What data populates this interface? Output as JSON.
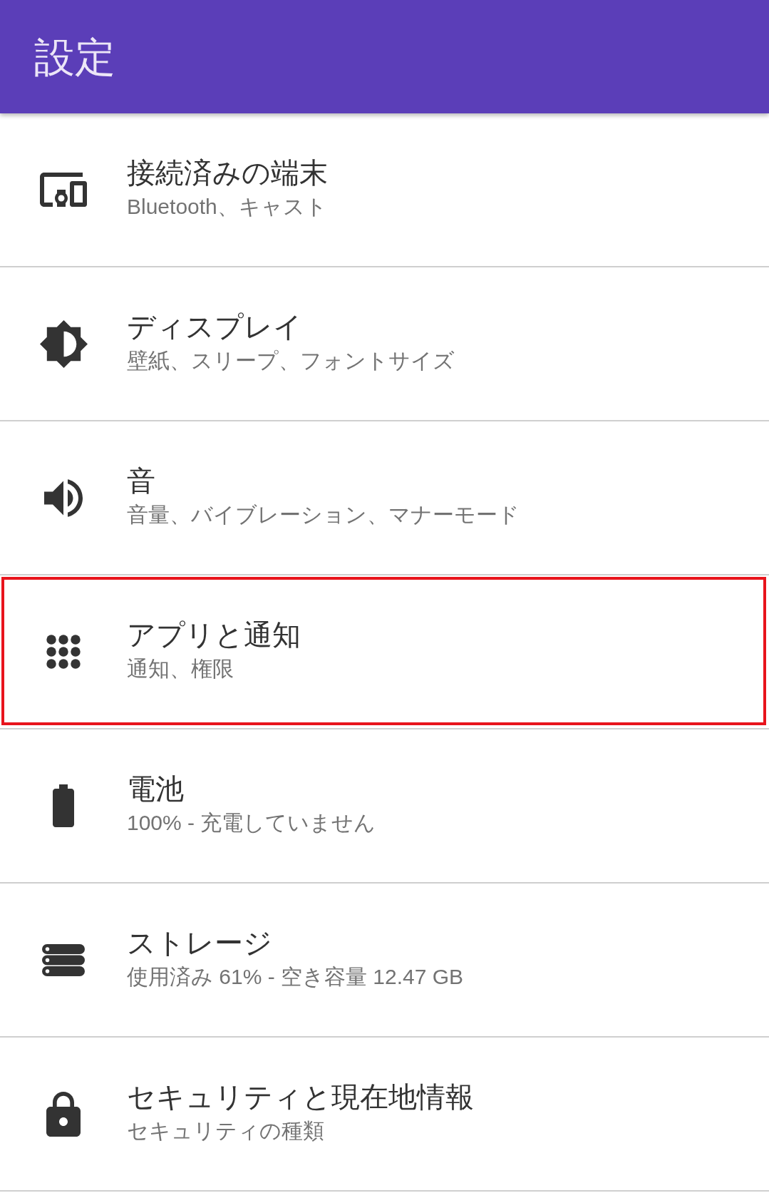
{
  "app_bar": {
    "title": "設定"
  },
  "items": [
    {
      "kind": "devices",
      "title": "接続済みの端末",
      "subtitle": "Bluetooth、キャスト",
      "highlighted": false
    },
    {
      "kind": "display",
      "title": "ディスプレイ",
      "subtitle": "壁紙、スリープ、フォントサイズ",
      "highlighted": false
    },
    {
      "kind": "sound",
      "title": "音",
      "subtitle": "音量、バイブレーション、マナーモード",
      "highlighted": false
    },
    {
      "kind": "apps",
      "title": "アプリと通知",
      "subtitle": "通知、権限",
      "highlighted": true
    },
    {
      "kind": "battery",
      "title": "電池",
      "subtitle": "100% - 充電していません",
      "highlighted": false
    },
    {
      "kind": "storage",
      "title": "ストレージ",
      "subtitle": "使用済み 61% - 空き容量 12.47 GB",
      "highlighted": false
    },
    {
      "kind": "security",
      "title": "セキュリティと現在地情報",
      "subtitle": "セキュリティの種類",
      "highlighted": false
    }
  ]
}
